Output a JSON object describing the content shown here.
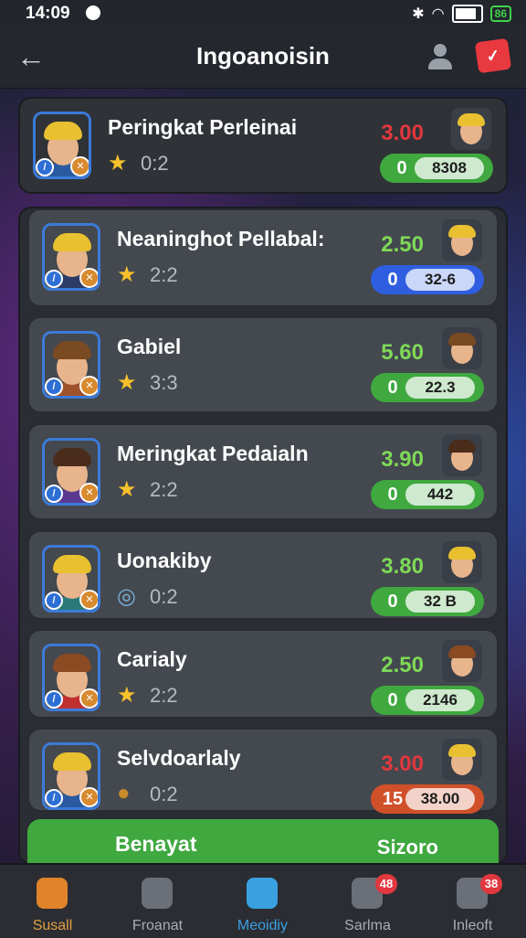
{
  "status_bar": {
    "time": "14:09",
    "battery_label": "86"
  },
  "header": {
    "title": "Ingoanoisin",
    "back_icon": "arrow-left-icon",
    "user_icon": "user-icon",
    "badge_icon": "notification-badge-icon"
  },
  "top_entry": {
    "name": "Peringkat Perleinai",
    "stars": "0:2",
    "score": "3.00",
    "pill_num": "0",
    "pill_value": "8308",
    "score_color": "#e0383e",
    "pill_color": "#3fa83f",
    "hair_color": "#e8c030",
    "shirt_color": "#2a5aa0"
  },
  "rows": [
    {
      "name": "Neaninghot Pellabal:",
      "icon": "star",
      "stat": "2:2",
      "score": "2.50",
      "pill_num": "0",
      "pill_value": "32-6",
      "score_color": "#7ed957",
      "pill_color": "#2f5fe0",
      "hair_color": "#e8c030",
      "shirt_color": "#2b3a66"
    },
    {
      "name": "Gabiel",
      "icon": "star",
      "stat": "3:3",
      "score": "5.60",
      "pill_num": "0",
      "pill_value": "22.3",
      "score_color": "#7ed957",
      "pill_color": "#3fa83f",
      "hair_color": "#7a4a22",
      "shirt_color": "#a0522d"
    },
    {
      "name": "Meringkat Pedaialn",
      "icon": "star",
      "stat": "2:2",
      "score": "3.90",
      "pill_num": "0",
      "pill_value": "442",
      "score_color": "#7ed957",
      "pill_color": "#3fa83f",
      "hair_color": "#4a2c1a",
      "shirt_color": "#5a3a90"
    },
    {
      "name": "Uonakiby",
      "icon": "swirl",
      "stat": "0:2",
      "score": "3.80",
      "pill_num": "0",
      "pill_value": "32 B",
      "score_color": "#7ed957",
      "pill_color": "#3fa83f",
      "hair_color": "#e8c030",
      "shirt_color": "#2a7a7a"
    },
    {
      "name": "Carialy",
      "icon": "star",
      "stat": "2:2",
      "score": "2.50",
      "pill_num": "0",
      "pill_value": "2146",
      "score_color": "#7ed957",
      "pill_color": "#3fa83f",
      "hair_color": "#8a4a22",
      "shirt_color": "#c03030"
    },
    {
      "name": "Selvdoarlaly",
      "icon": "coin",
      "stat": "0:2",
      "score": "3.00",
      "pill_num": "15",
      "pill_value": "38.00",
      "score_color": "#e0383e",
      "pill_color": "#d0502a",
      "hair_color": "#e8c030",
      "shirt_color": "#2a5aa0"
    }
  ],
  "bottom_row": {
    "name": "Benayat",
    "score": "Sizoro"
  },
  "nav": [
    {
      "label": "Susall",
      "icon": "home-icon",
      "badge": ""
    },
    {
      "label": "Froanat",
      "icon": "ranking-icon",
      "badge": ""
    },
    {
      "label": "Meoidiy",
      "icon": "info-icon",
      "badge": ""
    },
    {
      "label": "Sarlma",
      "icon": "trophy-icon",
      "badge": "48"
    },
    {
      "label": "Inleoft",
      "icon": "chat-icon",
      "badge": "38"
    }
  ]
}
